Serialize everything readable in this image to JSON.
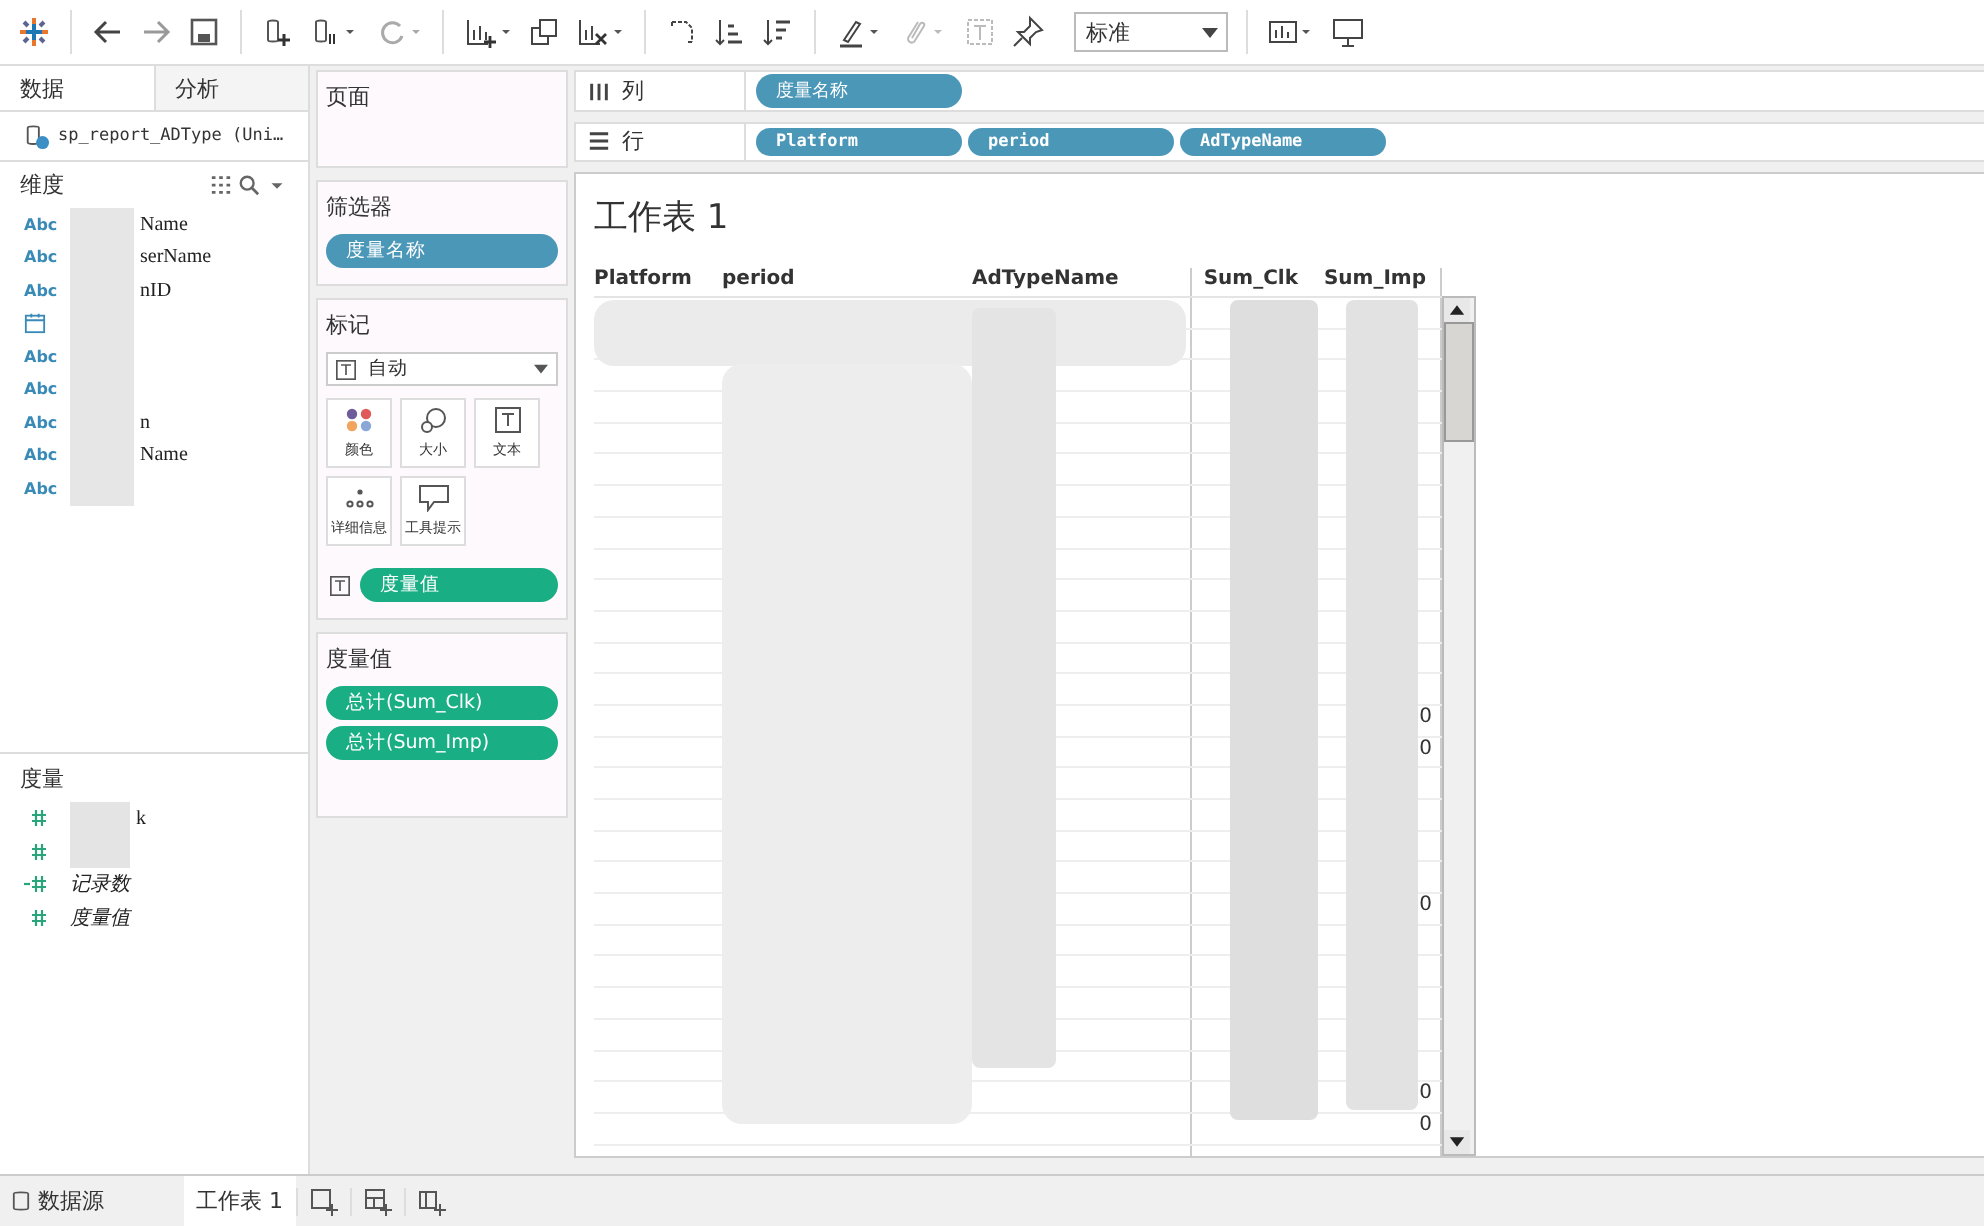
{
  "toolbar": {
    "fit_select": "标准"
  },
  "side_tabs": [
    {
      "label": "数据",
      "selected": true
    },
    {
      "label": "分析",
      "selected": false
    }
  ],
  "datasource": "sp_report_ADType (Uni…",
  "dimensions": {
    "title": "维度",
    "items": [
      {
        "kind": "text",
        "type_label": "Abc",
        "suffix": "Name"
      },
      {
        "kind": "text",
        "type_label": "Abc",
        "suffix": "serName"
      },
      {
        "kind": "text",
        "type_label": "Abc",
        "suffix": "nID"
      },
      {
        "kind": "date"
      },
      {
        "kind": "text",
        "type_label": "Abc"
      },
      {
        "kind": "text",
        "type_label": "Abc"
      },
      {
        "kind": "text",
        "type_label": "Abc",
        "suffix": "n"
      },
      {
        "kind": "text",
        "type_label": "Abc",
        "suffix": "Name"
      },
      {
        "kind": "text",
        "type_label": "Abc"
      }
    ]
  },
  "measures": {
    "title": "度量",
    "items": [
      {
        "kind": "number",
        "suffix": "k"
      },
      {
        "kind": "number"
      },
      {
        "kind": "calculated",
        "suffix": "记录数"
      },
      {
        "kind": "number",
        "suffix": "度量值"
      }
    ]
  },
  "pages_card": {
    "title": "页面"
  },
  "filters_card": {
    "title": "筛选器",
    "pills": [
      "度量名称"
    ]
  },
  "marks_card": {
    "title": "标记",
    "mark_type": "自动",
    "buttons": [
      {
        "kind": "color",
        "label": "颜色"
      },
      {
        "kind": "size",
        "label": "大小"
      },
      {
        "kind": "text",
        "label": "文本"
      },
      {
        "kind": "detail",
        "label": "详细信息"
      },
      {
        "kind": "tooltip",
        "label": "工具提示"
      }
    ],
    "text_pill": "度量值"
  },
  "measure_values_card": {
    "title": "度量值",
    "pills": [
      "总计(Sum_Clk)",
      "总计(Sum_Imp)"
    ]
  },
  "columns_shelf": {
    "label": "列",
    "pills": [
      "度量名称"
    ]
  },
  "rows_shelf": {
    "label": "行",
    "pills": [
      "Platform",
      "period",
      "AdTypeName"
    ]
  },
  "sheet": {
    "title": "工作表 1",
    "columns": [
      "Platform",
      "period",
      "AdTypeName",
      "Sum_Clk",
      "Sum_Imp"
    ],
    "rows": [
      {},
      {},
      {},
      {},
      {},
      {},
      {},
      {},
      {},
      {},
      {},
      {},
      {},
      {
        "sum_imp": "0"
      },
      {
        "sum_imp": "0"
      },
      {},
      {},
      {},
      {},
      {
        "sum_imp": "0"
      },
      {},
      {},
      {},
      {},
      {},
      {
        "sum_imp": "0"
      },
      {
        "sum_imp": "0"
      }
    ]
  },
  "bottom_tabs": [
    {
      "kind": "datasource",
      "label": "数据源",
      "selected": false
    },
    {
      "kind": "sheet",
      "label": "工作表 1",
      "selected": true
    }
  ]
}
